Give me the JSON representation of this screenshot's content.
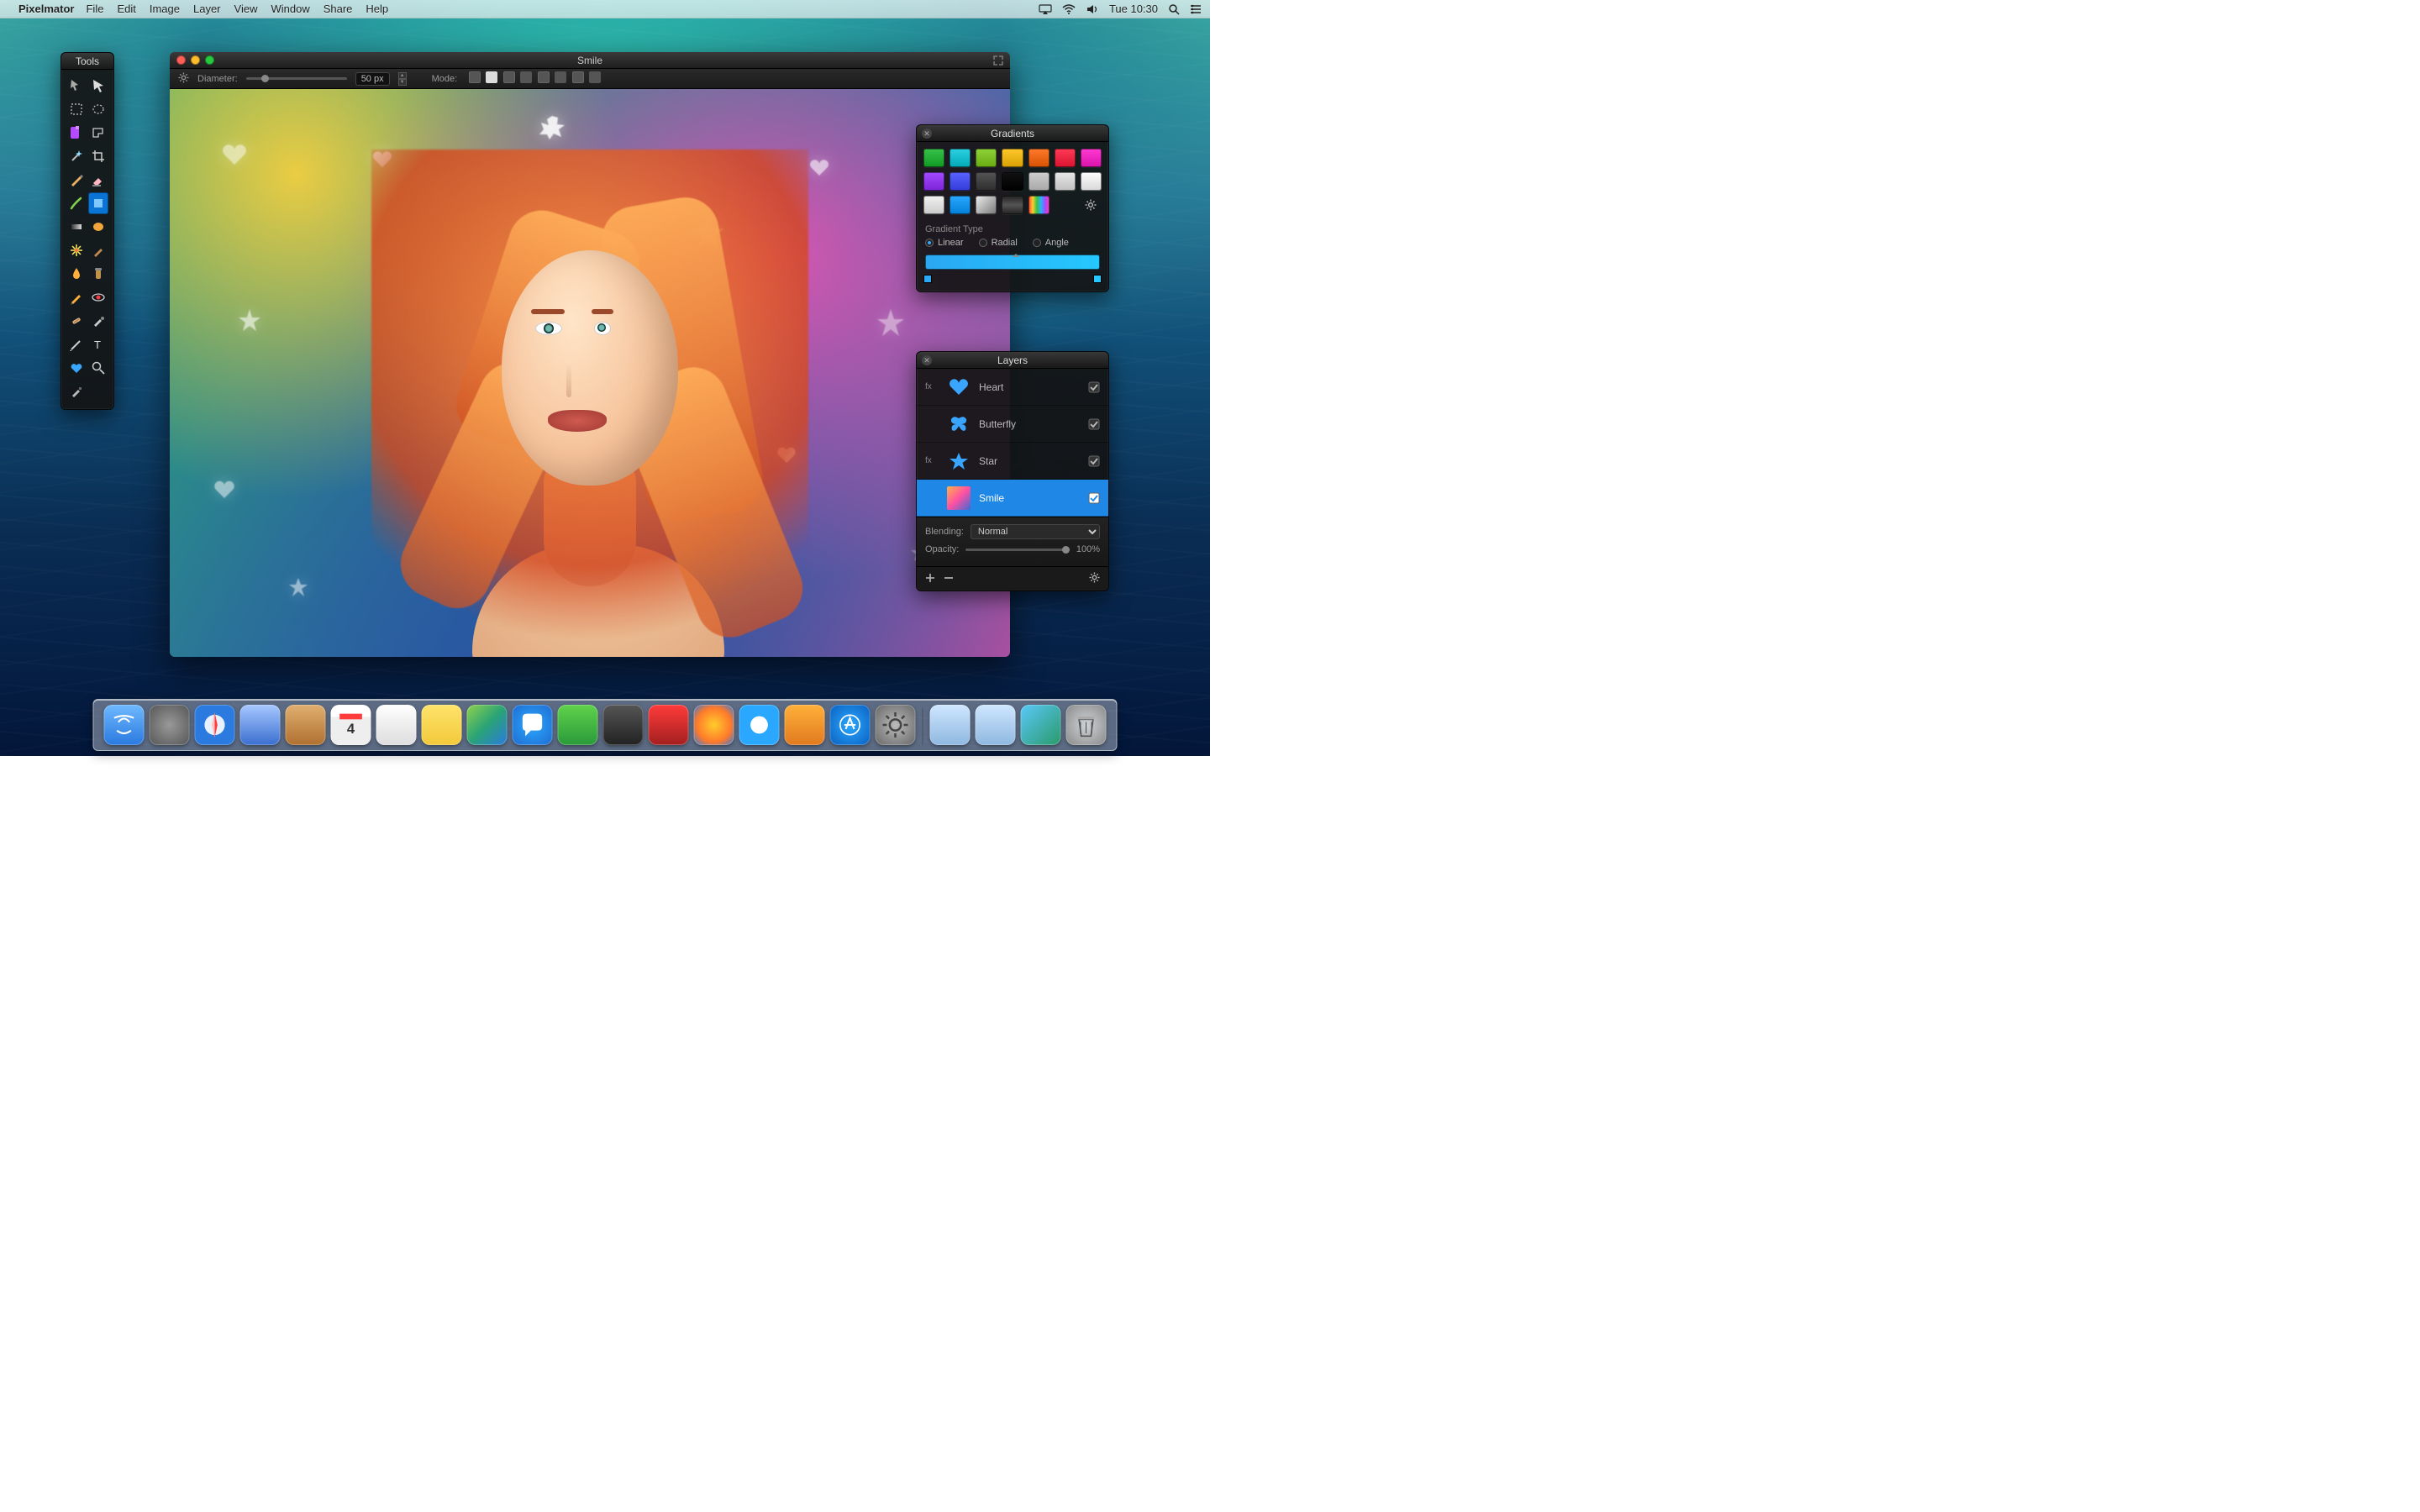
{
  "menubar": {
    "app": "Pixelmator",
    "items": [
      "File",
      "Edit",
      "Image",
      "Layer",
      "View",
      "Window",
      "Share",
      "Help"
    ],
    "clock": "Tue 10:30"
  },
  "tools_panel": {
    "title": "Tools"
  },
  "document": {
    "title": "Smile",
    "diameter_label": "Diameter:",
    "diameter_value": "50 px",
    "mode_label": "Mode:"
  },
  "gradients": {
    "title": "Gradients",
    "type_label": "Gradient Type",
    "linear": "Linear",
    "radial": "Radial",
    "angle": "Angle",
    "swatches": [
      "#38c24b",
      "#2bd1e0",
      "#8fd23a",
      "#ffc92b",
      "#ff7a2b",
      "#ff3b57",
      "#ff3bd4",
      "#a44bff",
      "#5a63ff",
      "#555555",
      "#111111",
      "#cfcfcf",
      "#e8e8e8",
      "#ffffff"
    ],
    "swatches_row3": [
      {
        "type": "solid",
        "value": "#f2f2f2"
      },
      {
        "type": "solid",
        "value": "#2aa8ff"
      },
      {
        "type": "gradient",
        "value": "linear-gradient(135deg,#f0f0f0,#777)"
      },
      {
        "type": "gradient",
        "value": "linear-gradient(180deg,#222,#555,#222)"
      },
      {
        "type": "gradient",
        "value": "linear-gradient(90deg,#ff3b3b,#ffcc2b,#38c24b,#2bb1ff,#a44bff,#ff3bb0)"
      }
    ]
  },
  "layers": {
    "title": "Layers",
    "items": [
      {
        "name": "Heart",
        "fx": true,
        "icon": "heart"
      },
      {
        "name": "Butterfly",
        "fx": false,
        "icon": "butterfly"
      },
      {
        "name": "Star",
        "fx": true,
        "icon": "star"
      },
      {
        "name": "Smile",
        "fx": false,
        "icon": "image",
        "selected": true
      }
    ],
    "blending_label": "Blending:",
    "blending_value": "Normal",
    "opacity_label": "Opacity:",
    "opacity_value": "100%"
  },
  "dock": {
    "apps": [
      "finder",
      "launchpad",
      "safari",
      "mail",
      "contacts",
      "calendar",
      "reminders",
      "notes",
      "maps",
      "messages",
      "facetime",
      "photobooth",
      "photos",
      "iphoto",
      "itunes",
      "ibooks",
      "appstore",
      "preferences"
    ],
    "right": [
      "documents",
      "downloads",
      "pictures",
      "trash"
    ]
  }
}
